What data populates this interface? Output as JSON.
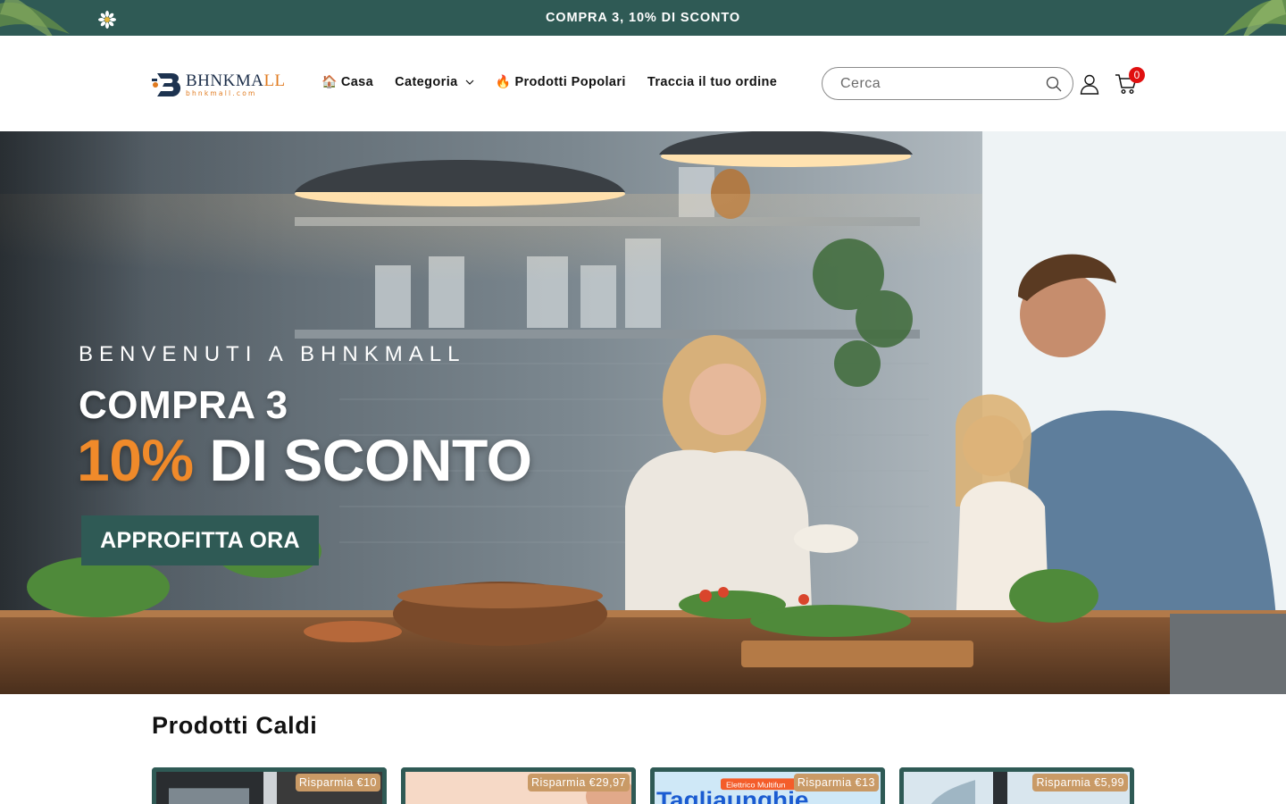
{
  "announcement": {
    "text": "COMPRA 3, 10% DI SCONTO"
  },
  "header": {
    "logo": {
      "brand_main": "BHNKMA",
      "brand_accent": "LL",
      "domain": "bhnkmall.com"
    },
    "nav": [
      {
        "emoji": "🏠",
        "label": "Casa"
      },
      {
        "label": "Categoria",
        "has_dropdown": true
      },
      {
        "emoji": "🔥",
        "label": "Prodotti Popolari"
      },
      {
        "label": "Traccia il tuo ordine"
      }
    ],
    "search": {
      "placeholder": "Cerca"
    },
    "cart": {
      "count": "0"
    }
  },
  "hero": {
    "kicker": "BENVENUTI A BHNKMALL",
    "line1": "COMPRA 3",
    "line2_pct": "10%",
    "line2_rest": " DI SCONTO",
    "cta": "APPROFITTA ORA"
  },
  "section": {
    "title": "Prodotti Caldi",
    "products": [
      {
        "badge": "Risparmia €10"
      },
      {
        "badge": "Risparmia €29,97"
      },
      {
        "badge": "Risparmia €13",
        "thumb_text": "Tagliaunghie",
        "thumb_tag": "Elettrico Multifun"
      },
      {
        "badge": "Risparmia €5,99"
      }
    ]
  },
  "colors": {
    "brand_teal": "#2f5a55",
    "accent_orange": "#f08a2a",
    "badge_tan": "#c99a66",
    "cart_badge_red": "#e01010"
  },
  "icons": [
    "daisy-icon",
    "home-icon",
    "fire-icon",
    "chevron-down-icon",
    "search-icon",
    "account-icon",
    "cart-icon"
  ]
}
